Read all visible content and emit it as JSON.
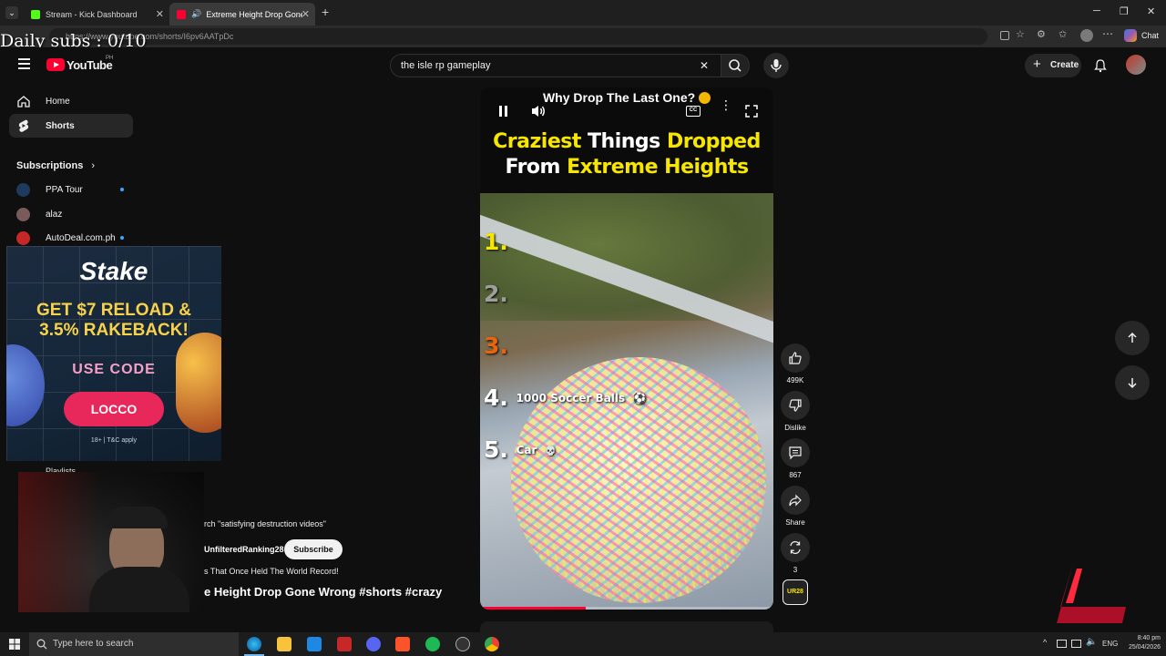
{
  "browser": {
    "tabs": [
      {
        "title": "Stream - Kick Dashboard",
        "fav_color": "#53fc18"
      },
      {
        "title": "Extreme Height Drop Gone W",
        "fav_color": "#ff0033"
      }
    ],
    "url": "https://www.youtube.com/shorts/I6pv6AATpDc",
    "chat_label": "Chat"
  },
  "overlay": {
    "daily_subs": "Daily subs : 0/10"
  },
  "youtube": {
    "logo_text": "YouTube",
    "region": "PH",
    "search_value": "the isle rp gameplay",
    "create_label": "Create"
  },
  "sidebar": {
    "items": [
      {
        "label": "Home",
        "icon": "home-icon"
      },
      {
        "label": "Shorts",
        "icon": "shorts-icon"
      }
    ],
    "subscriptions_label": "Subscriptions",
    "subs": [
      {
        "label": "PPA Tour",
        "color": "#1e3a5f"
      },
      {
        "label": "alaz",
        "color": "#7a5a5a"
      },
      {
        "label": "AutoDeal.com.ph",
        "color": "#c62828"
      }
    ],
    "playlists_label": "Playlists"
  },
  "stake_ad": {
    "brand": "Stake",
    "line1": "GET $7 RELOAD &",
    "line2": "3.5% RAKEBACK!",
    "use_code": "USE CODE",
    "code": "LOCCO",
    "disclaimer": "18+ | T&C apply"
  },
  "short": {
    "sticker": "Why Drop The Last One?",
    "title_white_1": "Craziest",
    "title_yellow_1": "Things",
    "title_white_2": "Dropped",
    "title_white_3": "From",
    "title_yellow_2": "Extreme Heights",
    "list": [
      {
        "num": "1.",
        "text": "",
        "color": "#f7e600"
      },
      {
        "num": "2.",
        "text": "",
        "color": "#9e9e9e"
      },
      {
        "num": "3.",
        "text": "",
        "color": "#e8650d"
      },
      {
        "num": "4.",
        "text": "1000 Soccer Balls",
        "color": "#ffffff"
      },
      {
        "num": "5.",
        "text": "Car",
        "color": "#ffffff"
      }
    ],
    "progress": 0.36,
    "search_hint": "rch \"satisfying destruction videos\"",
    "channel": "UnfilteredRanking28",
    "subscribe_label": "Subscribe",
    "subtitle": "s That Once Held The World Record!",
    "video_title": "e Height Drop Gone Wrong #shorts #crazy"
  },
  "actions": {
    "likes": "499K",
    "dislike": "Dislike",
    "comments": "867",
    "share": "Share",
    "remix": "3"
  },
  "taskbar": {
    "search_placeholder": "Type here to search",
    "lang": "ENG",
    "time": "8:40 pm",
    "date": "25/04/2026"
  }
}
